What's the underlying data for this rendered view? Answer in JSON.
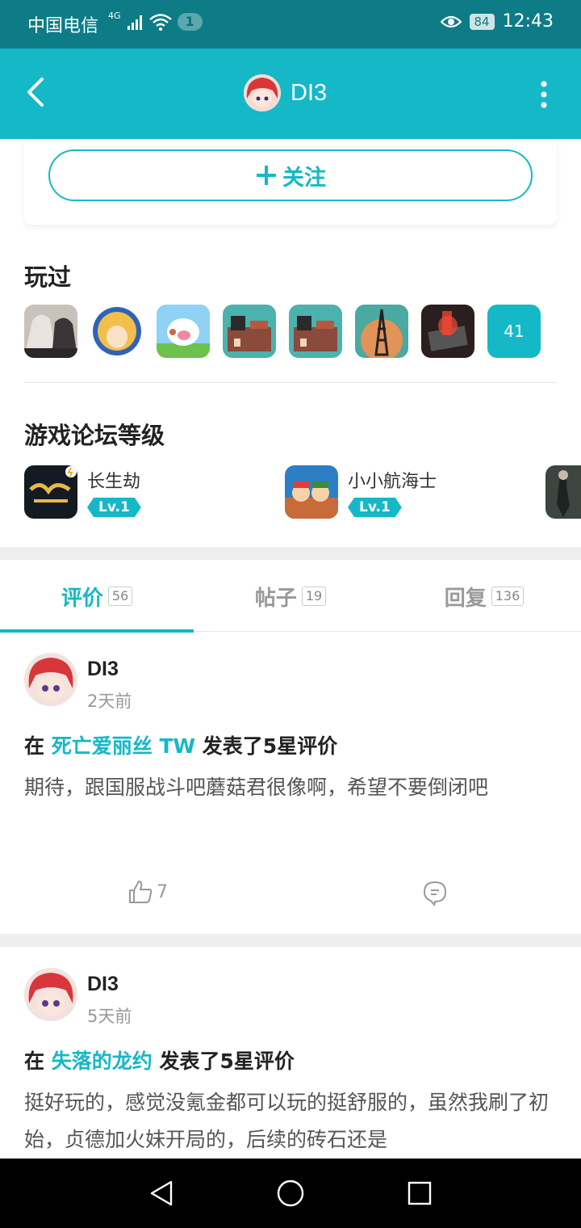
{
  "status_bar": {
    "carrier": "中国电信",
    "network": "4G",
    "notification_count": "1",
    "battery": "84",
    "time": "12:43"
  },
  "header": {
    "username": "DI3",
    "back_icon": "chevron-left-icon",
    "more_icon": "more-vertical-icon"
  },
  "follow_button": {
    "label": "关注",
    "icon": "plus-icon"
  },
  "played": {
    "title": "玩过",
    "more_count": "41",
    "games": [
      {
        "icon": "game-icon-1",
        "color": "#b0a9a3"
      },
      {
        "icon": "game-icon-2",
        "color": "#2e63b8"
      },
      {
        "icon": "game-icon-3",
        "color": "#7cc6ee"
      },
      {
        "icon": "game-icon-4",
        "color": "#3c9e9b"
      },
      {
        "icon": "game-icon-5",
        "color": "#3c9e9b"
      },
      {
        "icon": "game-icon-6",
        "color": "#d8874f"
      },
      {
        "icon": "game-icon-7",
        "color": "#b8322b"
      }
    ]
  },
  "forum_levels": {
    "title": "游戏论坛等级",
    "items": [
      {
        "name": "长生劫",
        "level": "Lv.1"
      },
      {
        "name": "小小航海士",
        "level": "Lv.1"
      }
    ]
  },
  "tabs": [
    {
      "label": "评价",
      "count": "56",
      "active": true
    },
    {
      "label": "帖子",
      "count": "19",
      "active": false
    },
    {
      "label": "回复",
      "count": "136",
      "active": false
    }
  ],
  "posts": [
    {
      "author": "DI3",
      "time": "2天前",
      "prefix": "在",
      "game": "死亡爱丽丝 TW",
      "suffix": "发表了5星评价",
      "body": "期待，跟国服战斗吧蘑菇君很像啊，希望不要倒闭吧",
      "likes": "7"
    },
    {
      "author": "DI3",
      "time": "5天前",
      "prefix": "在",
      "game": "失落的龙约",
      "suffix": "发表了5星评价",
      "body": "挺好玩的，感觉没氪金都可以玩的挺舒服的，虽然我刷了初始，贞德加火妹开局的，后续的砖石还是"
    }
  ],
  "theme": {
    "accent": "#15b8c7",
    "status_bar": "#0d7c86"
  }
}
